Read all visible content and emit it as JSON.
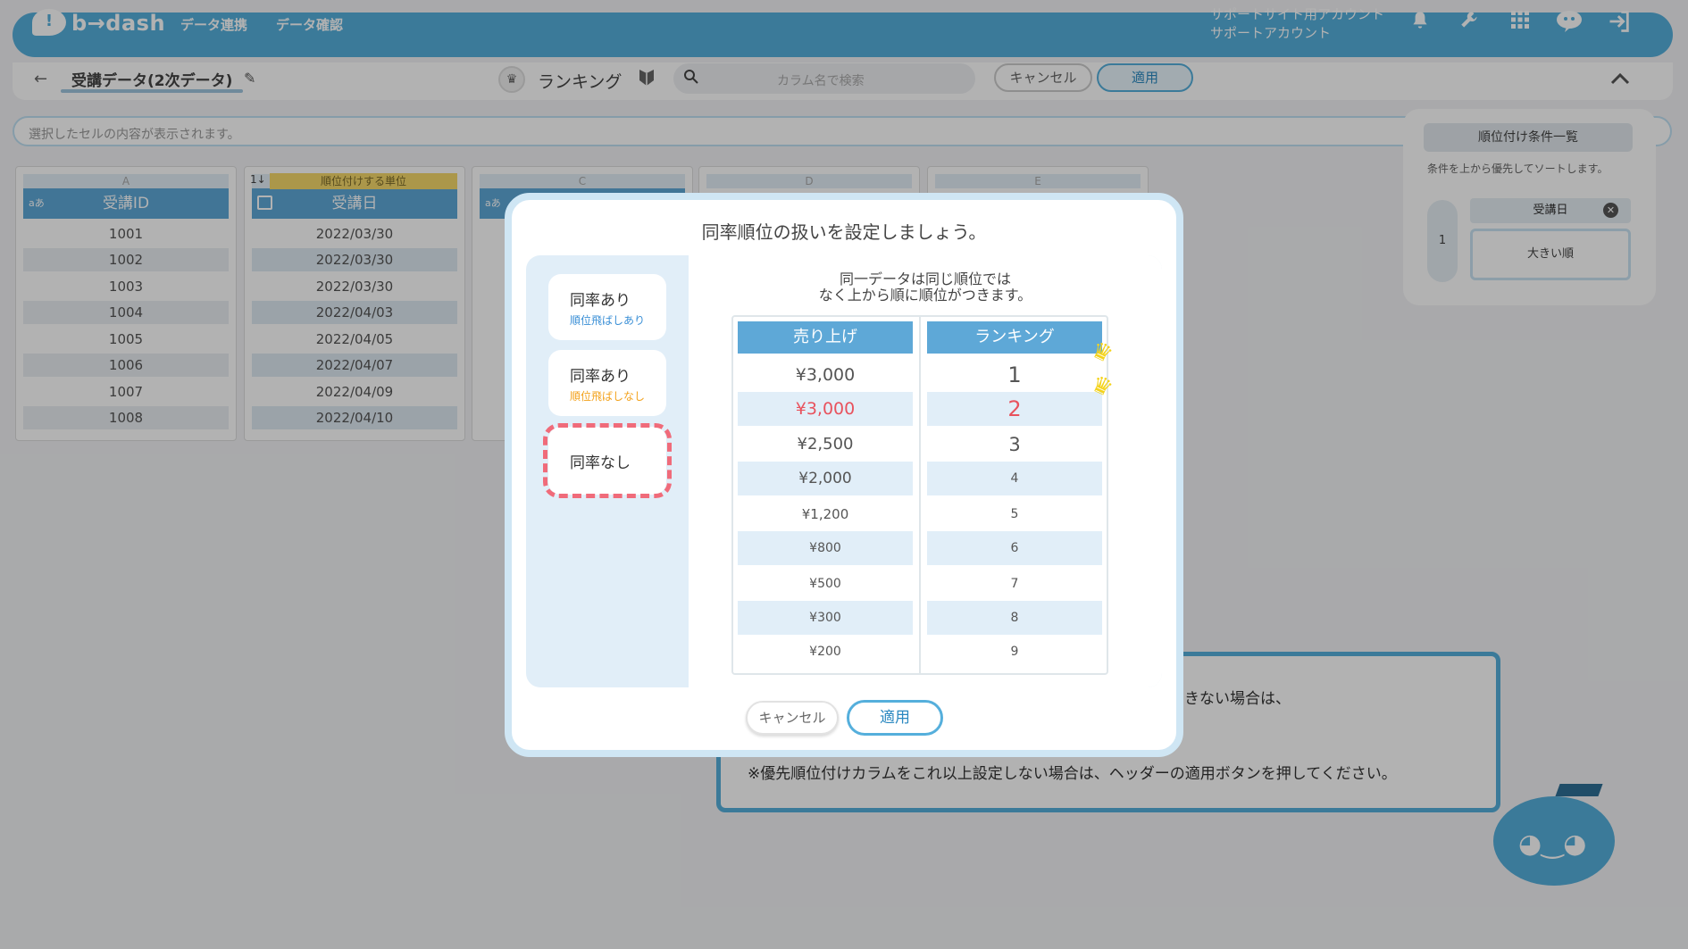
{
  "app": {
    "logo_text": "b→dash",
    "nav": [
      "データ連携",
      "データ確認"
    ],
    "account_lines": [
      "サポートサイト用アカウント",
      "サポートアカウント"
    ],
    "brand_color": "#55afdc"
  },
  "header": {
    "dataset_title": "受講データ(2次データ)",
    "ranking_label": "ランキング",
    "search_placeholder": "カラム名で検索",
    "cancel_label": "キャンセル",
    "apply_label": "適用"
  },
  "cell_preview": "選択したセルの内容が表示されます。",
  "sheet": {
    "ranking_unit_label": "順位付けする単位",
    "ranking_unit_icon": "1↓",
    "columns": [
      {
        "letter": "A",
        "type_tag": "aあ",
        "header": "受講ID",
        "cells": [
          "1001",
          "1002",
          "1003",
          "1004",
          "1005",
          "1006",
          "1007",
          "1008"
        ]
      },
      {
        "letter": "B",
        "type_tag": "",
        "header": "受講日",
        "cells": [
          "2022/03/30",
          "2022/03/30",
          "2022/03/30",
          "2022/04/03",
          "2022/04/05",
          "2022/04/07",
          "2022/04/09",
          "2022/04/10"
        ]
      },
      {
        "letter": "C",
        "type_tag": "aあ",
        "header": "",
        "cells": []
      },
      {
        "letter": "D",
        "type_tag": "",
        "header": "",
        "cells": []
      },
      {
        "letter": "E",
        "type_tag": "",
        "header": "",
        "cells": []
      }
    ]
  },
  "conditions_panel": {
    "title": "順位付け条件一覧",
    "note": "条件を上から優先してソートします。",
    "items": [
      {
        "index": "1",
        "field": "受講日",
        "order": "大きい順"
      }
    ]
  },
  "help_bubble": {
    "line1": "きない場合は、",
    "line2": "※優先順位付けカラムをこれ以上設定しない場合は、ヘッダーの適用ボタンを押してください。"
  },
  "modal": {
    "title": "同率順位の扱いを設定しましょう。",
    "options": [
      {
        "title": "同率あり",
        "subtitle": "順位飛ばしあり",
        "subtitle_color": "#3a8fd6"
      },
      {
        "title": "同率あり",
        "subtitle": "順位飛ばしなし",
        "subtitle_color": "#f3a21c"
      },
      {
        "title": "同率なし",
        "subtitle": "",
        "subtitle_color": ""
      }
    ],
    "selected_option": "同率なし",
    "description_lines": [
      "同一データは同じ順位では",
      "なく上から順に順位がつきます。"
    ],
    "table": {
      "headers": [
        "売り上げ",
        "ランキング"
      ],
      "rows": [
        {
          "sales": "¥3,000",
          "rank": "1"
        },
        {
          "sales": "¥3,000",
          "rank": "2"
        },
        {
          "sales": "¥2,500",
          "rank": "3"
        },
        {
          "sales": "¥2,000",
          "rank": "4"
        },
        {
          "sales": "¥1,200",
          "rank": "5"
        },
        {
          "sales": "¥800",
          "rank": "6"
        },
        {
          "sales": "¥500",
          "rank": "7"
        },
        {
          "sales": "¥300",
          "rank": "8"
        },
        {
          "sales": "¥200",
          "rank": "9"
        }
      ],
      "highlight_color": "#e8525d"
    },
    "cancel_label": "キャンセル",
    "apply_label": "適用"
  }
}
